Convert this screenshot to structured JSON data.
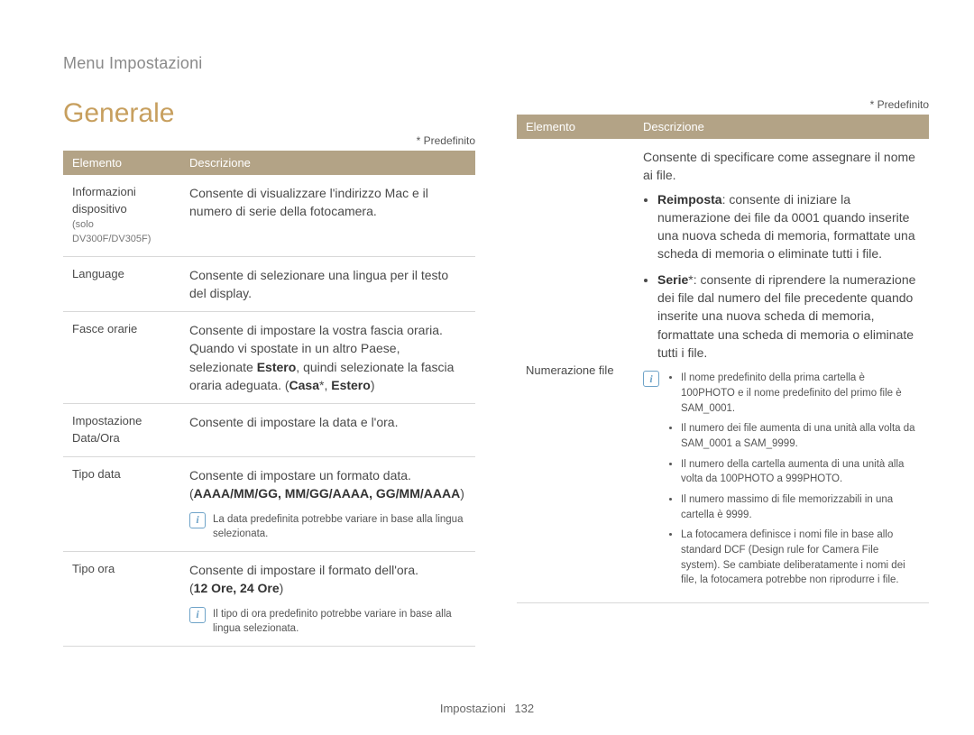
{
  "breadcrumb": "Menu Impostazioni",
  "title": "Generale",
  "predef_label": "* Predefinito",
  "table_headers": {
    "element": "Elemento",
    "desc": "Descrizione"
  },
  "left": {
    "r1": {
      "label": "Informazioni dispositivo",
      "sub": "(solo DV300F/DV305F)",
      "desc": "Consente di visualizzare l'indirizzo Mac e il numero di serie della fotocamera."
    },
    "r2": {
      "label": "Language",
      "desc": "Consente di selezionare una lingua per il testo del display."
    },
    "r3": {
      "label": "Fasce orarie",
      "desc_pre": "Consente di impostare la vostra fascia oraria. Quando vi spostate in un altro Paese, selezionate ",
      "desc_bold1": "Estero",
      "desc_mid": ", quindi selezionate la fascia oraria adeguata. (",
      "desc_bold2": "Casa",
      "desc_star": "*, ",
      "desc_bold3": "Estero",
      "desc_end": ")"
    },
    "r4": {
      "label": "Impostazione Data/Ora",
      "desc": "Consente di impostare la data e l'ora."
    },
    "r5": {
      "label": "Tipo data",
      "line1": "Consente di impostare un formato data.",
      "line2_pre": "(",
      "line2_bold": "AAAA/MM/GG, MM/GG/AAAA, GG/MM/AAAA",
      "line2_post": ")",
      "note": "La data predefinita potrebbe variare in base alla lingua selezionata."
    },
    "r6": {
      "label": "Tipo ora",
      "line1": "Consente di impostare il formato dell'ora.",
      "line2_pre": "(",
      "line2_bold": "12 Ore, 24 Ore",
      "line2_post": ")",
      "note": "Il tipo di ora predefinito potrebbe variare in base alla lingua selezionata."
    }
  },
  "right": {
    "r1": {
      "label": "Numerazione file",
      "intro": "Consente di specificare come assegnare il nome ai file.",
      "b1_bold": "Reimposta",
      "b1_text": ": consente di iniziare la numerazione dei file da 0001 quando inserite una nuova scheda di memoria, formattate una scheda di memoria o eliminate tutti i file.",
      "b2_bold": "Serie",
      "b2_star": "*",
      "b2_text": ": consente di riprendere la numerazione dei file dal numero del file precedente quando inserite una nuova scheda di memoria, formattate una scheda di memoria o eliminate tutti i file.",
      "notes": [
        "Il nome predefinito della prima cartella è 100PHOTO e il nome predefinito del primo file è SAM_0001.",
        "Il numero dei file aumenta di una unità alla volta da SAM_0001 a SAM_9999.",
        "Il numero della cartella aumenta di una unità alla volta da 100PHOTO a 999PHOTO.",
        "Il numero massimo di file memorizzabili in una cartella è 9999.",
        "La fotocamera definisce i nomi file in base allo standard DCF (Design rule for Camera File system). Se cambiate deliberatamente i nomi dei file, la fotocamera potrebbe non riprodurre i file."
      ]
    }
  },
  "footer": {
    "section": "Impostazioni",
    "page": "132"
  }
}
